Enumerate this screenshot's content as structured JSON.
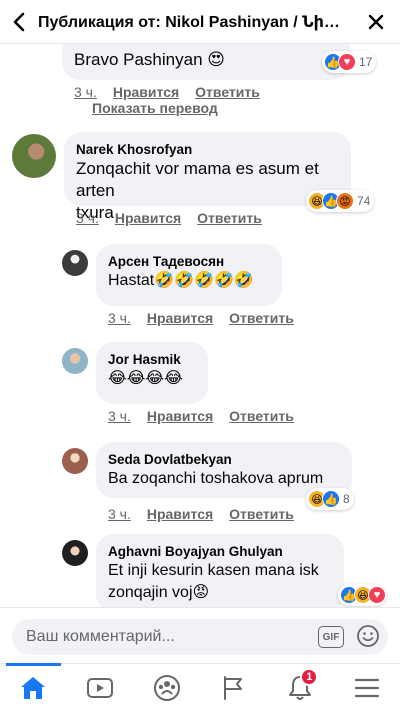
{
  "header": {
    "title": "Публикация от: Nikol Pashinyan / Նիկո..."
  },
  "comments": [
    {
      "text": "Bravo Pashinyan 😍",
      "time": "3 ч.",
      "like_label": "Нравится",
      "reply_label": "Ответить",
      "translate_label": "Показать перевод",
      "reaction_count": "17"
    },
    {
      "author": "Narek  Khosrofyan",
      "text_line1": "Zonqachit vor mama es asum et arten",
      "text_line2": "txura",
      "time": "3 ч.",
      "like_label": "Нравится",
      "reply_label": "Ответить",
      "reaction_count": "74"
    },
    {
      "author": "Арсен Тадевосян",
      "text": "Hastat🤣🤣🤣🤣🤣",
      "time": "3 ч.",
      "like_label": "Нравится",
      "reply_label": "Ответить"
    },
    {
      "author": "Jor Hasmik",
      "text": "😂😂😂😂",
      "time": "3 ч.",
      "like_label": "Нравится",
      "reply_label": "Ответить"
    },
    {
      "author": "Seda Dovlatbekyan",
      "text": "Ba zoqanchi toshakova aprum",
      "time": "3 ч.",
      "like_label": "Нравится",
      "reply_label": "Ответить",
      "reaction_count": "8"
    },
    {
      "author": "Aghavni Boyajyan Ghulyan",
      "text_line1": "Et inji kesurin kasen mana isk",
      "text_line2": "zonqajin voj😡"
    }
  ],
  "composer": {
    "placeholder": "Ваш комментарий...",
    "gif_label": "GIF"
  },
  "nav": {
    "notification_count": "1",
    "accent": "#1877f2"
  }
}
